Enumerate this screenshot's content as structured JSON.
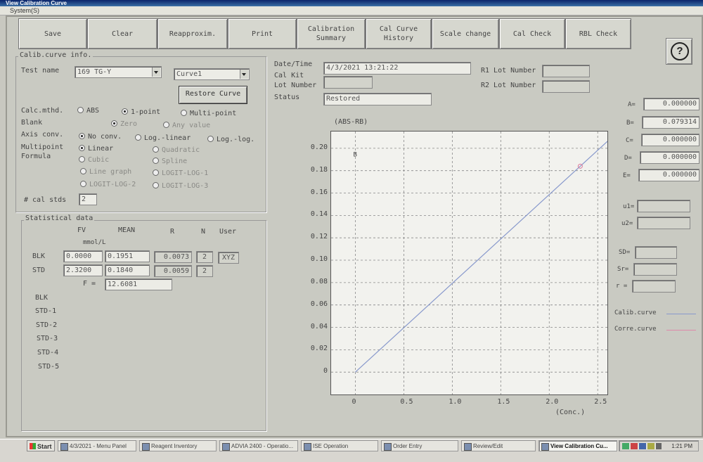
{
  "window": {
    "title": "View Calibration Curve",
    "menu": "System(S)"
  },
  "toolbar": {
    "buttons": [
      "Save",
      "Clear",
      "Reapproxim.",
      "Print",
      "Calibration\nSummary",
      "Cal Curve\nHistory",
      "Scale change",
      "Cal Check",
      "RBL Check"
    ],
    "help": "?"
  },
  "calib_info": {
    "title": "Calib.curve info.",
    "test_name_label": "Test name",
    "test_name_value": "169 TG-Y",
    "curve_value": "Curve1",
    "restore_button": "Restore Curve",
    "calc_mthd_label": "Calc.mthd.",
    "calc_options": [
      "ABS",
      "1-point",
      "Multi-point"
    ],
    "blank_label": "Blank",
    "blank_options": [
      "Zero",
      "Any value"
    ],
    "axis_conv_label": "Axis conv.",
    "axis_options": [
      "No conv.",
      "Log.-linear",
      "Log.-log."
    ],
    "multipoint_label": "Multipoint",
    "formula_label": "Formula",
    "formula_options": [
      "Linear",
      "Quadratic",
      "Cubic",
      "Spline",
      "Line graph",
      "LOGIT-LOG-1",
      "LOGIT-LOG-2",
      "LOGIT-LOG-3"
    ],
    "cal_stds_label": "# cal stds",
    "cal_stds_value": "2"
  },
  "stats": {
    "title": "Statistical data",
    "headers": {
      "fv": "FV",
      "unit": "mmol/L",
      "mean": "MEAN",
      "r": "R",
      "n": "N",
      "user": "User"
    },
    "rows": [
      {
        "label": "BLK",
        "fv": "0.0000",
        "mean": "0.1951",
        "r": "0.0073",
        "n": "2",
        "user": "XYZ"
      },
      {
        "label": "STD",
        "fv": "2.3200",
        "mean": "0.1840",
        "r": "0.0059",
        "n": "2",
        "user": ""
      }
    ],
    "f_label": "F =",
    "f_value": "12.6081",
    "list": [
      "BLK",
      "STD-1",
      "STD-2",
      "STD-3",
      "STD-4",
      "STD-5"
    ]
  },
  "header": {
    "date_label": "Date/Time",
    "date_value": "4/3/2021 13:21:22",
    "cal_kit_label": "Cal Kit",
    "lot_label": "Lot Number",
    "status_label": "Status",
    "status_value": "Restored",
    "r1_label": "R1 Lot Number",
    "r2_label": "R2 Lot Number"
  },
  "coefficients": [
    {
      "label": "A=",
      "value": "0.000000"
    },
    {
      "label": "B=",
      "value": "0.079314"
    },
    {
      "label": "C=",
      "value": "0.000000"
    },
    {
      "label": "D=",
      "value": "0.000000"
    },
    {
      "label": "E=",
      "value": "0.000000"
    }
  ],
  "extra_fields": [
    "u1=",
    "u2=",
    "SD=",
    "Sr=",
    "r ="
  ],
  "legend": [
    {
      "label": "Calib.curve",
      "color": "#8899cc"
    },
    {
      "label": "Corre.curve",
      "color": "#dd88aa"
    }
  ],
  "chart_data": {
    "type": "line",
    "ylabel": "(ABS-RB)",
    "xlabel": "(Conc.)",
    "xlim": [
      -0.25,
      2.6
    ],
    "ylim": [
      -0.02,
      0.215
    ],
    "x_ticks": [
      "0",
      "0.5",
      "1.0",
      "1.5",
      "2.0",
      "2.5"
    ],
    "y_ticks": [
      "0",
      "0.02",
      "0.04",
      "0.06",
      "0.08",
      "0.10",
      "0.12",
      "0.14",
      "0.16",
      "0.18",
      "0.20"
    ],
    "series": [
      {
        "name": "Calib.curve",
        "color": "#8899cc",
        "x": [
          0,
          2.6
        ],
        "y": [
          0,
          0.2062
        ]
      }
    ],
    "points": [
      {
        "x": 0.0,
        "y": 0.1951,
        "symbol": "B"
      },
      {
        "x": 2.32,
        "y": 0.184,
        "symbol": "o",
        "color": "#dd7799"
      }
    ],
    "grid": true
  },
  "taskbar": {
    "start": "Start",
    "items": [
      "4/3/2021 - Menu Panel",
      "Reagent Inventory",
      "ADVIA 2400 - Operatio...",
      "ISE Operation",
      "Order Entry",
      "Review/Edit",
      "View Calibration Cu..."
    ],
    "clock": "1:21 PM"
  }
}
